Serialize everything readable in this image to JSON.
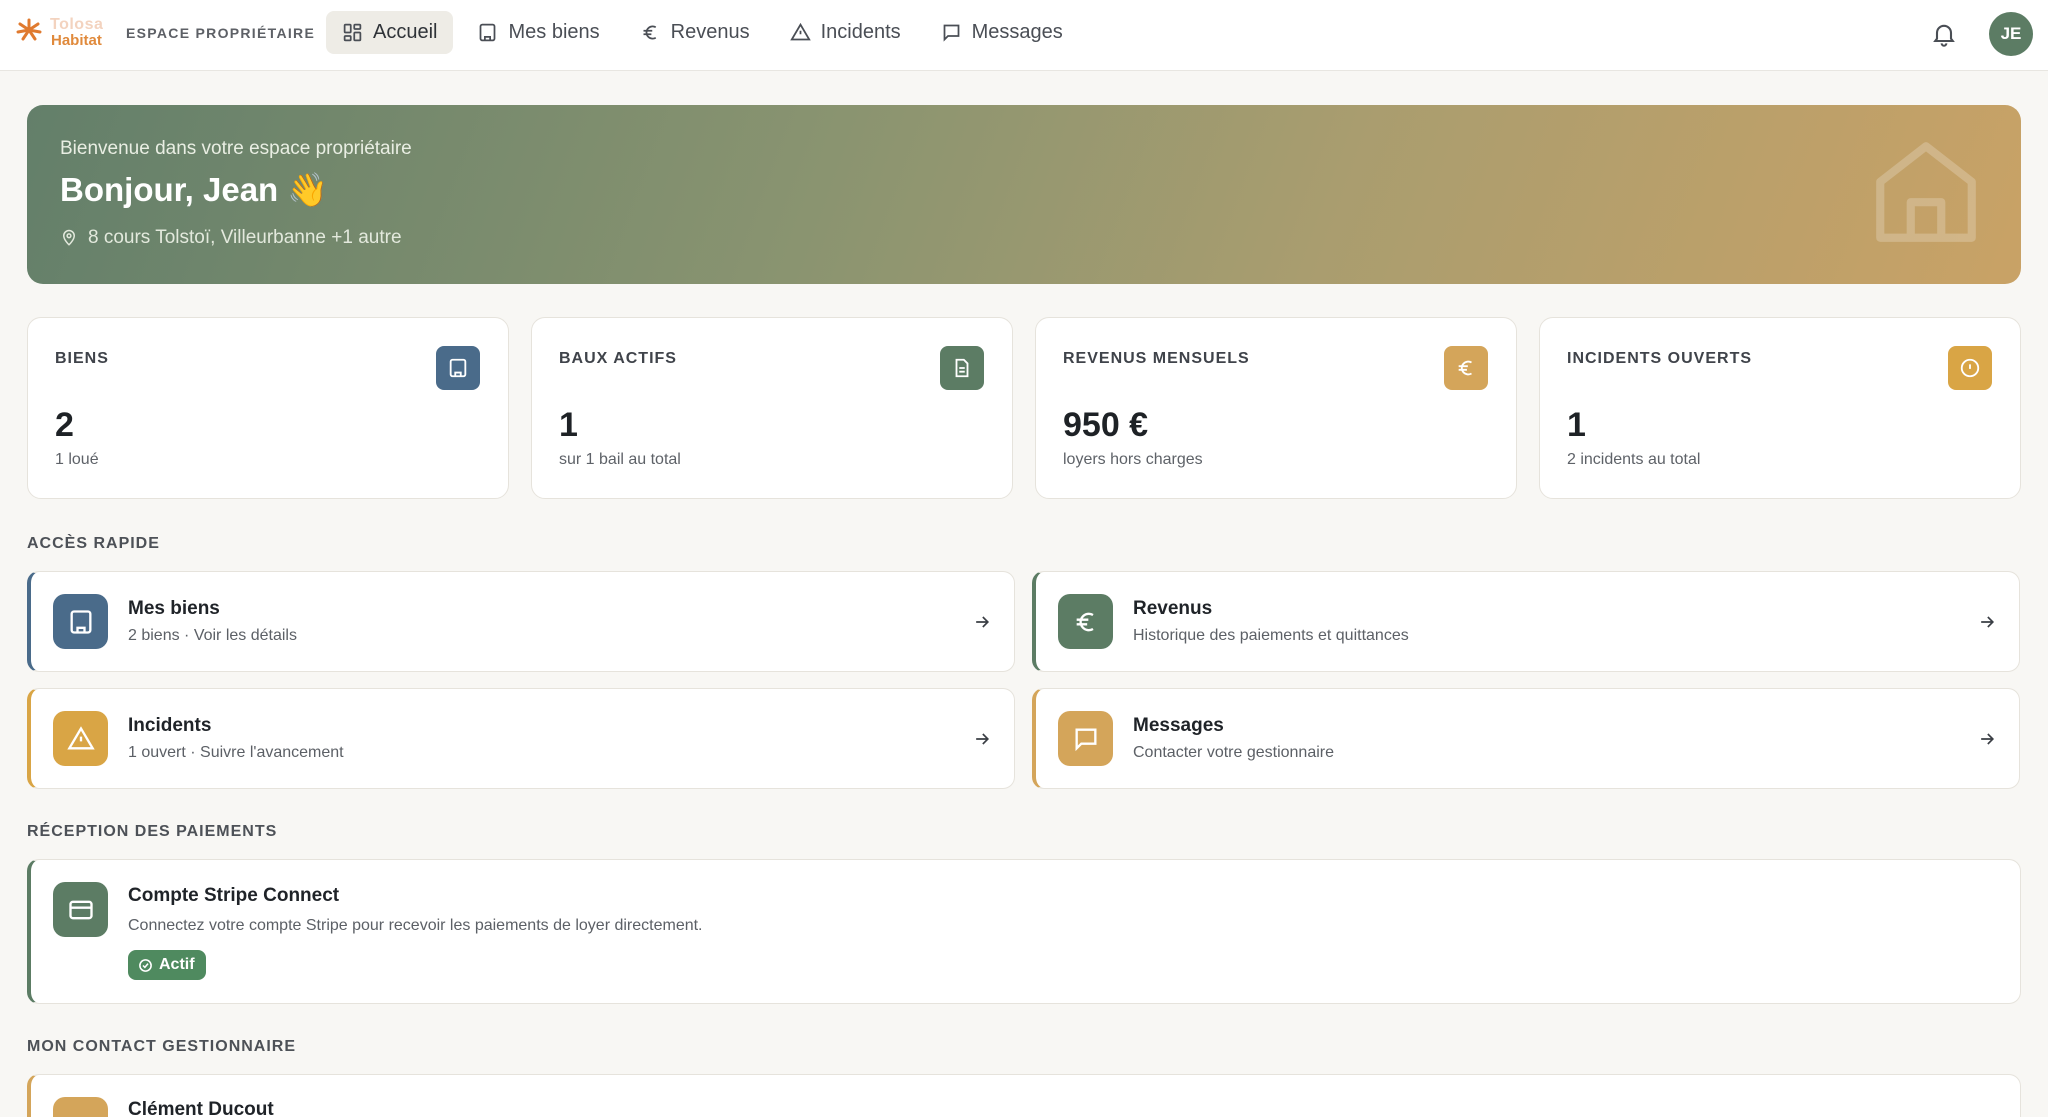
{
  "brand": {
    "name_top": "Tolosa",
    "name_bottom": "Habitat",
    "space_label": "ESPACE PROPRIÉTAIRE"
  },
  "nav": {
    "items": [
      {
        "label": "Accueil",
        "icon": "dashboard-icon",
        "active": true
      },
      {
        "label": "Mes biens",
        "icon": "building-icon",
        "active": false
      },
      {
        "label": "Revenus",
        "icon": "euro-icon",
        "active": false
      },
      {
        "label": "Incidents",
        "icon": "warning-icon",
        "active": false
      },
      {
        "label": "Messages",
        "icon": "message-icon",
        "active": false
      }
    ],
    "user_initials": "JE"
  },
  "hero": {
    "welcome": "Bienvenue dans votre espace propriétaire",
    "greeting": "Bonjour, Jean 👋",
    "address": "8 cours Tolstoï, Villeurbanne +1 autre"
  },
  "stats": [
    {
      "label": "BIENS",
      "value": "2",
      "sub": "1 loué",
      "icon": "building-icon",
      "color": "#4a6b8a"
    },
    {
      "label": "BAUX ACTIFS",
      "value": "1",
      "sub": "sur 1 bail au total",
      "icon": "document-icon",
      "color": "#5c7c64"
    },
    {
      "label": "REVENUS MENSUELS",
      "value": "950 €",
      "sub": "loyers hors charges",
      "icon": "euro-icon",
      "color": "#d4a55a"
    },
    {
      "label": "INCIDENTS OUVERTS",
      "value": "1",
      "sub": "2 incidents au total",
      "icon": "alert-circle-icon",
      "color": "#d9a545"
    }
  ],
  "quick_access": {
    "title": "ACCÈS RAPIDE",
    "items": [
      {
        "title": "Mes biens",
        "sub": "2 biens · Voir les détails",
        "icon": "building-icon",
        "color": "#4a6b8a"
      },
      {
        "title": "Revenus",
        "sub": "Historique des paiements et quittances",
        "icon": "euro-icon",
        "color": "#5c7c64"
      },
      {
        "title": "Incidents",
        "sub": "1 ouvert · Suivre l'avancement",
        "icon": "warning-icon",
        "color": "#d9a545"
      },
      {
        "title": "Messages",
        "sub": "Contacter votre gestionnaire",
        "icon": "message-icon",
        "color": "#d4a55a"
      }
    ]
  },
  "payments": {
    "title": "RÉCEPTION DES PAIEMENTS",
    "card_title": "Compte Stripe Connect",
    "card_sub": "Connectez votre compte Stripe pour recevoir les paiements de loyer directement.",
    "status": "Actif"
  },
  "contact": {
    "title": "MON CONTACT GESTIONNAIRE",
    "name": "Clément Ducout"
  }
}
